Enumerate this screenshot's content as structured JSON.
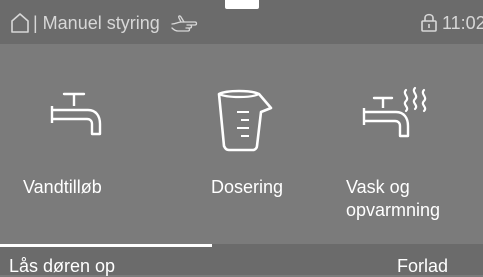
{
  "header": {
    "breadcrumb": "| Manuel styring",
    "time": "11:02",
    "icons": [
      "home-icon",
      "hand-icon",
      "lock-icon"
    ]
  },
  "tiles": [
    {
      "label": "Vandtilløb",
      "icon": "water-tap-icon"
    },
    {
      "label": "Dosering",
      "icon": "measuring-cup-icon"
    },
    {
      "label": "Vask og\nopvarmning",
      "icon": "tap-with-steam-icon"
    }
  ],
  "footer": {
    "left_label": "Lås døren op",
    "right_label": "Forlad"
  },
  "colors": {
    "background": "#7b7b7b",
    "bar": "#6b6b6b",
    "text": "#ffffff",
    "muted_text": "#d7d7d7"
  }
}
